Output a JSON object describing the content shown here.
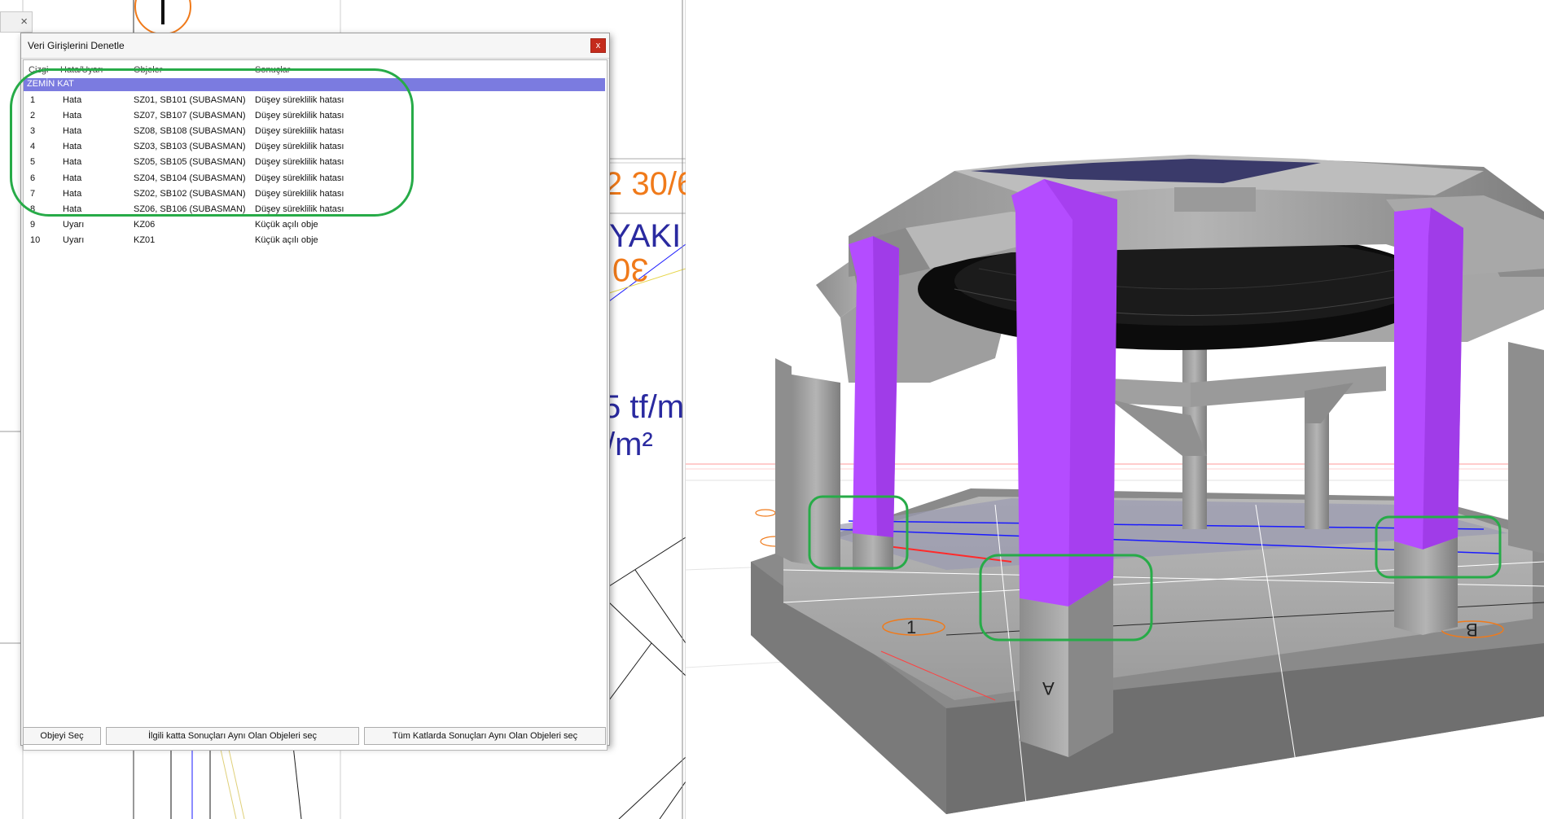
{
  "left_canvas": {
    "close_tab_glyph": "×",
    "fragment_1": "2 30/6",
    "fragment_2": "YAKI",
    "fragment_3": "30",
    "fragment_4": "5 tf/m",
    "fragment_5": "/m²"
  },
  "dialog": {
    "title": "Veri Girişlerini Denetle",
    "close_glyph": "x",
    "columns": [
      "Çizgi",
      "Hata/Uyarı",
      "Objeler",
      "Sonuçlar"
    ],
    "group": "ZEMİN KAT",
    "rows": [
      {
        "no": "1",
        "type": "Hata",
        "objects": "SZ01, SB101 (SUBASMAN)",
        "result": "Düşey süreklilik hatası"
      },
      {
        "no": "2",
        "type": "Hata",
        "objects": "SZ07, SB107 (SUBASMAN)",
        "result": "Düşey süreklilik hatası"
      },
      {
        "no": "3",
        "type": "Hata",
        "objects": "SZ08, SB108 (SUBASMAN)",
        "result": "Düşey süreklilik hatası"
      },
      {
        "no": "4",
        "type": "Hata",
        "objects": "SZ03, SB103 (SUBASMAN)",
        "result": "Düşey süreklilik hatası"
      },
      {
        "no": "5",
        "type": "Hata",
        "objects": "SZ05, SB105 (SUBASMAN)",
        "result": "Düşey süreklilik hatası"
      },
      {
        "no": "6",
        "type": "Hata",
        "objects": "SZ04, SB104 (SUBASMAN)",
        "result": "Düşey süreklilik hatası"
      },
      {
        "no": "7",
        "type": "Hata",
        "objects": "SZ02, SB102 (SUBASMAN)",
        "result": "Düşey süreklilik hatası"
      },
      {
        "no": "8",
        "type": "Hata",
        "objects": "SZ06, SB106 (SUBASMAN)",
        "result": "Düşey süreklilik hatası"
      },
      {
        "no": "9",
        "type": "Uyarı",
        "objects": "KZ06",
        "result": "Küçük açılı obje"
      },
      {
        "no": "10",
        "type": "Uyarı",
        "objects": "KZ01",
        "result": "Küçük açılı obje"
      }
    ],
    "buttons": {
      "select_object": "Objeyi Seç",
      "select_same_floor": "İlgili katta Sonuçları Aynı Olan Objeleri seç",
      "select_all_floors": "Tüm Katlarda Sonuçları Aynı Olan Objeleri seç"
    }
  },
  "view3d": {
    "axis_label_1": "1",
    "axis_label_a": "A",
    "axis_label_b": "B"
  },
  "colors": {
    "group_row": "#7b7be0",
    "highlight": "#27ab48",
    "column_magenta": "#b44cff",
    "close_button": "#c42b1c",
    "drawing_orange": "#f07a1a",
    "drawing_blue": "#2a2aa0"
  }
}
